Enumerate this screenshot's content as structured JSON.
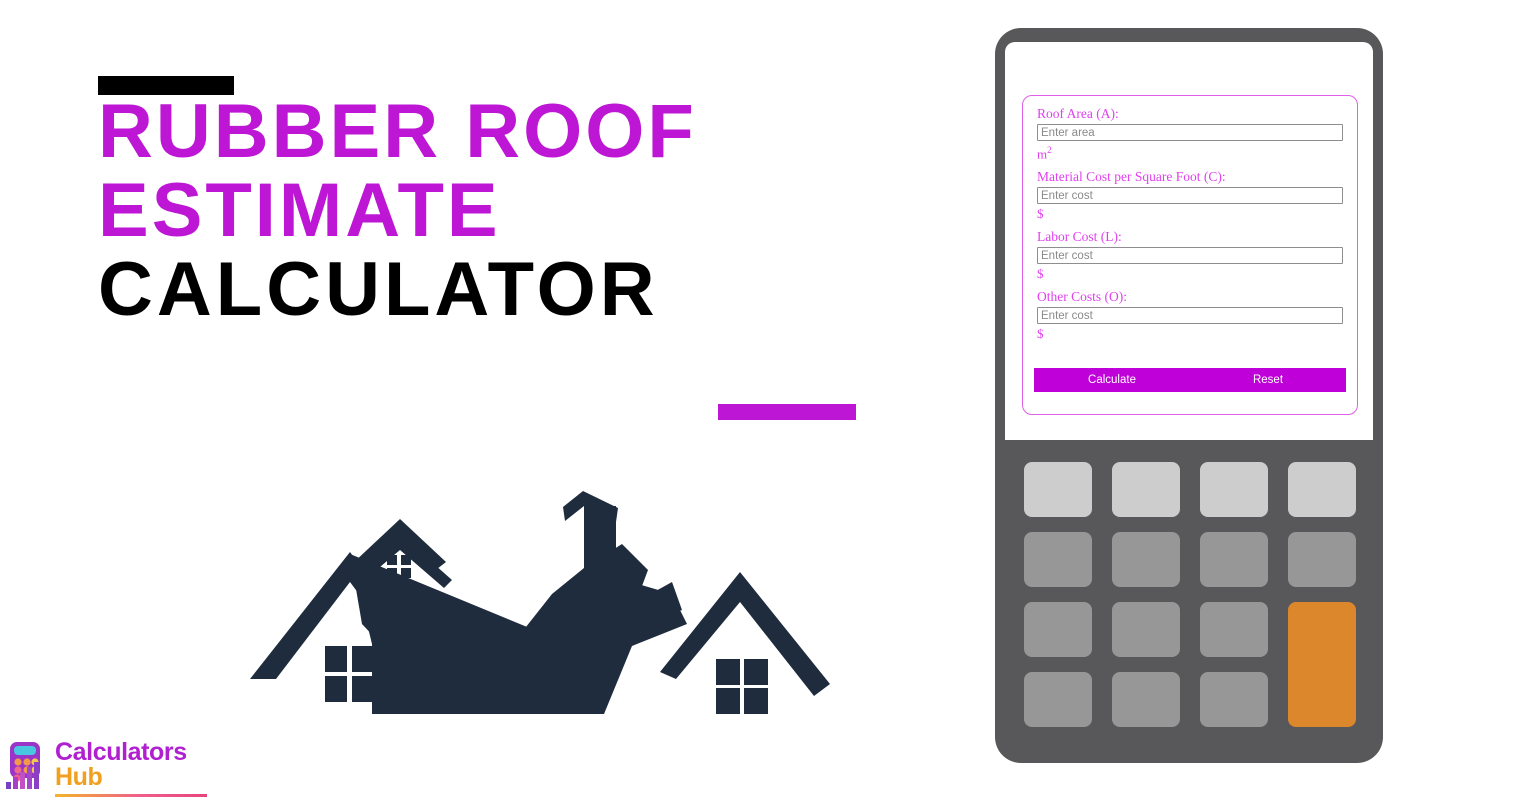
{
  "page": {
    "background_color": "#ffffff",
    "accent_purple": "#bd16d4",
    "accent_magenta": "#bf00d8",
    "accent_orange": "#dd872c",
    "illustration_color": "#1e2c3d"
  },
  "hero": {
    "title_line_1": "Rubber Roof",
    "title_line_2": "Estimate",
    "title_line_3": "Calculator",
    "top_rule_color": "#000000",
    "bottom_rule_color": "#bd16d4",
    "illustration_name": "house-rooftops-silhouette"
  },
  "logo": {
    "word_primary": "Calculators",
    "word_secondary": "Hub",
    "icon_name": "calculator-bar-chart-logo-icon",
    "primary_color": "#b01fd0",
    "secondary_color": "#f0a01e"
  },
  "calculator": {
    "device_color": "#58585a",
    "screen_color": "#ffffff",
    "form": {
      "border_color": "#e05fe8",
      "fields": [
        {
          "label": "Roof Area (A):",
          "placeholder": "Enter area",
          "value": "",
          "unit": "m",
          "unit_sup": "2",
          "name": "roof-area"
        },
        {
          "label": "Material Cost per Square Foot (C):",
          "placeholder": "Enter cost",
          "value": "",
          "unit": "$",
          "unit_sup": "",
          "name": "material-cost"
        },
        {
          "label": "Labor Cost (L):",
          "placeholder": "Enter cost",
          "value": "",
          "unit": "$",
          "unit_sup": "",
          "name": "labor-cost"
        },
        {
          "label": "Other Costs (O):",
          "placeholder": "Enter cost",
          "value": "",
          "unit": "$",
          "unit_sup": "",
          "name": "other-costs"
        }
      ],
      "calculate_label": "Calculate",
      "reset_label": "Reset"
    },
    "keypad": {
      "rows": 4,
      "columns": 4,
      "light_key_color": "#cdcdcd",
      "gray_key_color": "#979797",
      "accent_key_color": "#dd872c",
      "keys_blank": true
    }
  }
}
